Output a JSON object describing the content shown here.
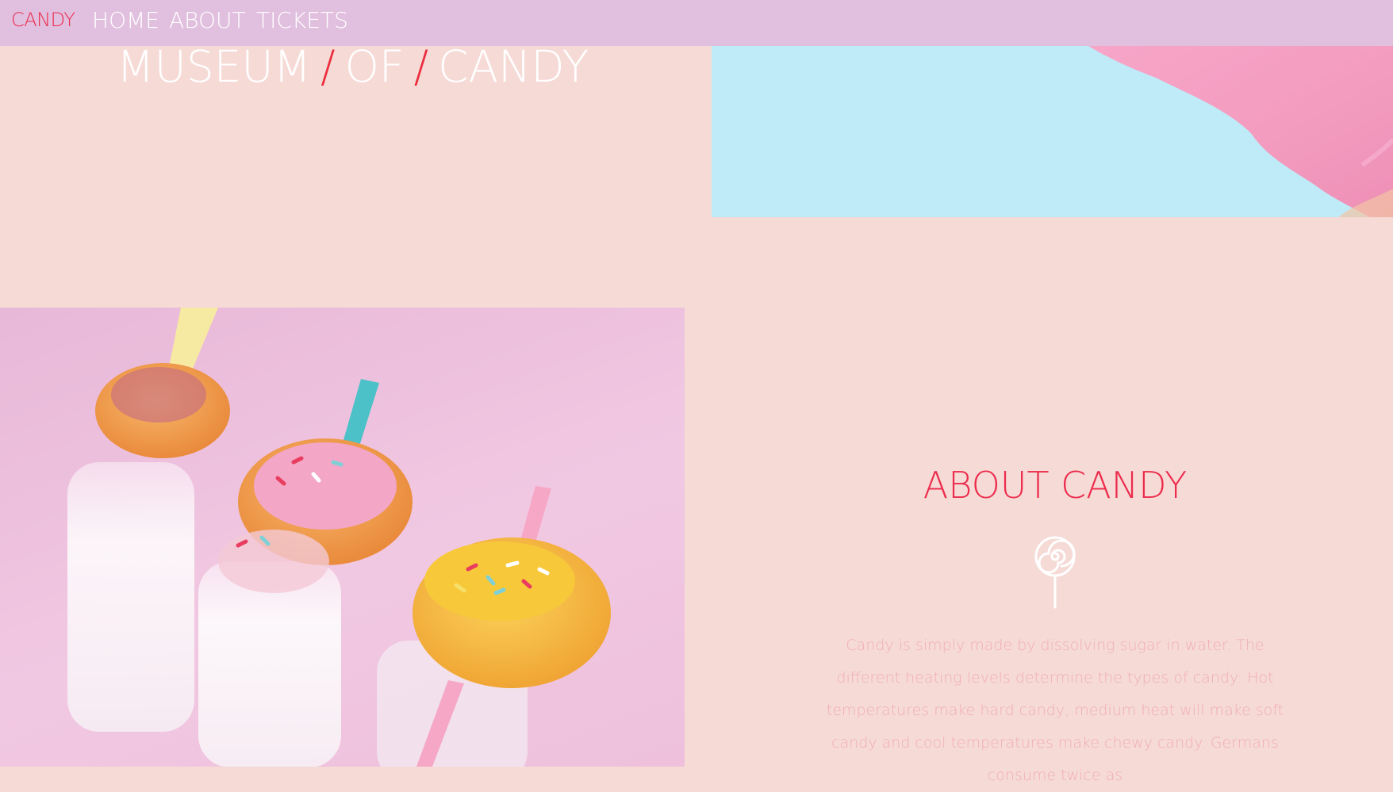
{
  "nav": {
    "brand": "CANDY",
    "links": [
      "HOME",
      "ABOUT",
      "TICKETS"
    ]
  },
  "hero": {
    "title_words": [
      "MUSEUM",
      "OF",
      "CANDY"
    ],
    "separator": "/"
  },
  "about": {
    "title": "ABOUT CANDY",
    "icon": "lollipop-icon",
    "text": "Candy is simply made by dissolving sugar in water. The different heating levels determine the types of candy: Hot temperatures make hard candy, medium heat will make soft candy and cool temperatures make chewy candy. Germans consume twice as"
  },
  "colors": {
    "nav_bg": "#e1bfdf",
    "page_bg": "#f6dad6",
    "accent": "#ec2c4c",
    "body_text": "#f0aeb8",
    "photo_blue": "#bfeaf7"
  }
}
